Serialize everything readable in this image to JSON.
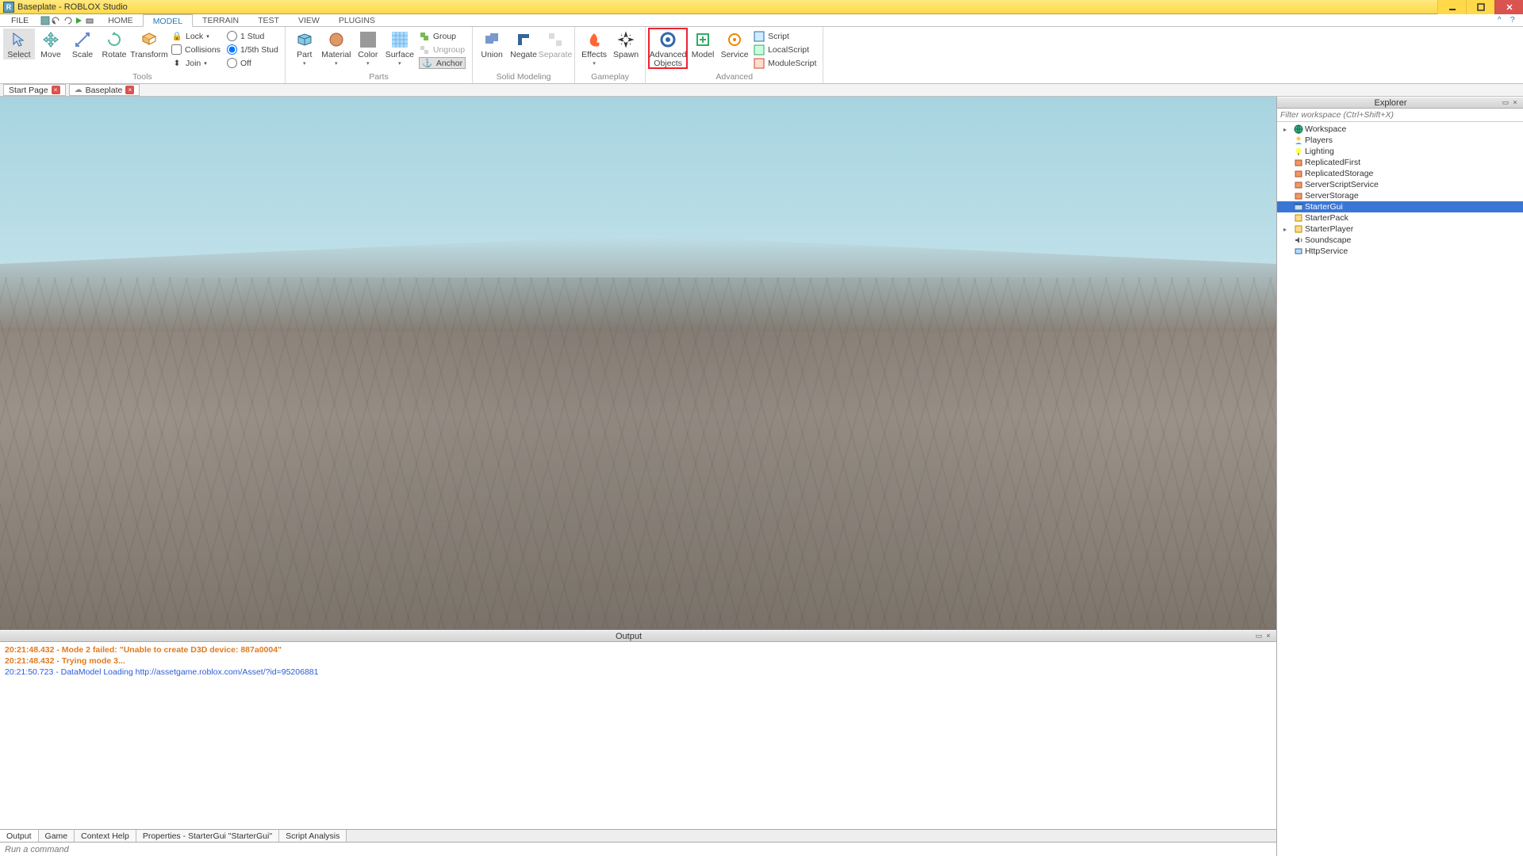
{
  "title": "Baseplate - ROBLOX Studio",
  "menu": {
    "file": "FILE",
    "tabs": [
      "HOME",
      "MODEL",
      "TERRAIN",
      "TEST",
      "VIEW",
      "PLUGINS"
    ],
    "active": 1
  },
  "ribbon": {
    "tools": {
      "name": "Tools",
      "select": "Select",
      "move": "Move",
      "scale": "Scale",
      "rotate": "Rotate",
      "transform": "Transform",
      "lock": "Lock",
      "collisions": "Collisions",
      "join": "Join",
      "snap": {
        "one": "1 Stud",
        "fifth": "1/5th Stud",
        "off": "Off"
      }
    },
    "parts": {
      "name": "Parts",
      "part": "Part",
      "material": "Material",
      "color": "Color",
      "surface": "Surface",
      "group": "Group",
      "ungroup": "Ungroup",
      "anchor": "Anchor"
    },
    "solid": {
      "name": "Solid Modeling",
      "union": "Union",
      "negate": "Negate",
      "separate": "Separate"
    },
    "gameplay": {
      "name": "Gameplay",
      "effects": "Effects",
      "spawn": "Spawn"
    },
    "advanced": {
      "name": "Advanced",
      "advobj": "Advanced\nObjects",
      "model": "Model",
      "service": "Service",
      "script": "Script",
      "local": "LocalScript",
      "module": "ModuleScript"
    }
  },
  "doctabs": {
    "start": "Start Page",
    "bp": "Baseplate"
  },
  "explorer": {
    "title": "Explorer",
    "filter_ph": "Filter workspace (Ctrl+Shift+X)",
    "items": [
      {
        "label": "Workspace",
        "icon": "globe",
        "exp": true
      },
      {
        "label": "Players",
        "icon": "players"
      },
      {
        "label": "Lighting",
        "icon": "bulb"
      },
      {
        "label": "ReplicatedFirst",
        "icon": "box"
      },
      {
        "label": "ReplicatedStorage",
        "icon": "box"
      },
      {
        "label": "ServerScriptService",
        "icon": "box"
      },
      {
        "label": "ServerStorage",
        "icon": "box"
      },
      {
        "label": "StarterGui",
        "icon": "gui",
        "selected": true
      },
      {
        "label": "StarterPack",
        "icon": "pack"
      },
      {
        "label": "StarterPlayer",
        "icon": "pack",
        "exp": true
      },
      {
        "label": "Soundscape",
        "icon": "sound"
      },
      {
        "label": "HttpService",
        "icon": "http"
      }
    ]
  },
  "output": {
    "title": "Output",
    "lines": [
      {
        "t": "20:21:48.432 - Mode 2 failed: \"Unable to create D3D device: 887a0004\"",
        "c": "orange"
      },
      {
        "t": "20:21:48.432 - Trying mode 3...",
        "c": "orange"
      },
      {
        "t": "20:21:50.723 - DataModel Loading http://assetgame.roblox.com/Asset/?id=95206881",
        "c": "blue"
      }
    ]
  },
  "bottom_tabs": [
    "Output",
    "Game",
    "Context Help",
    "Properties - StarterGui \"StarterGui\"",
    "Script Analysis"
  ],
  "cmd_ph": "Run a command"
}
